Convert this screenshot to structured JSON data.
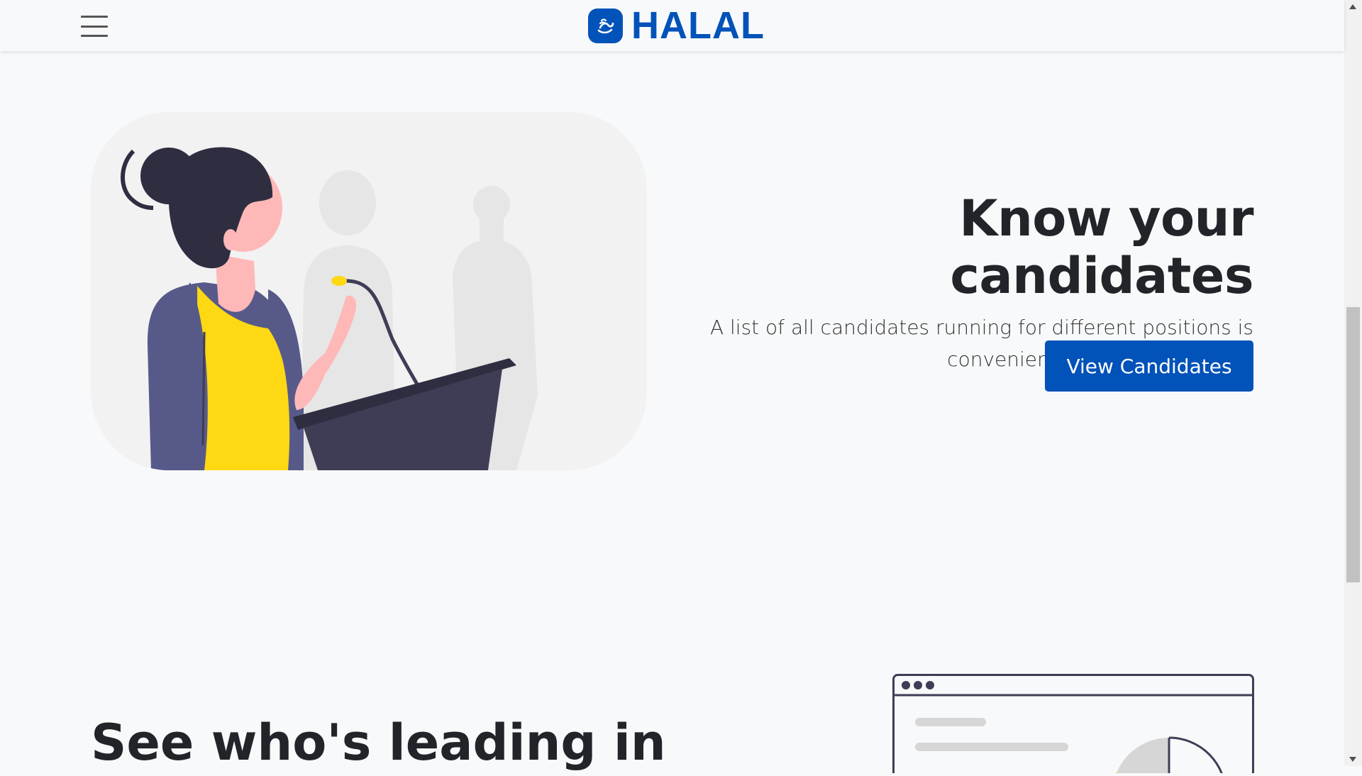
{
  "navbar": {
    "brand_text": "HALAL",
    "menu_icon": "hamburger-menu-icon",
    "logo_icon": "halal-logo-icon"
  },
  "hero": {
    "title": "Know your candidates",
    "subtitle": "A list of all candidates running for different positions is conveniently available for you.",
    "button_label": "View Candidates",
    "illustration": "speaker-at-podium-illustration"
  },
  "section2": {
    "title": "See who's leading in",
    "illustration": "browser-window-chart-illustration"
  },
  "colors": {
    "brand_blue": "#0152b9",
    "page_bg": "#f8f9fa",
    "text_dark": "#212529",
    "accent_yellow": "#ffd814",
    "illustration_dark": "#3f3d56"
  }
}
